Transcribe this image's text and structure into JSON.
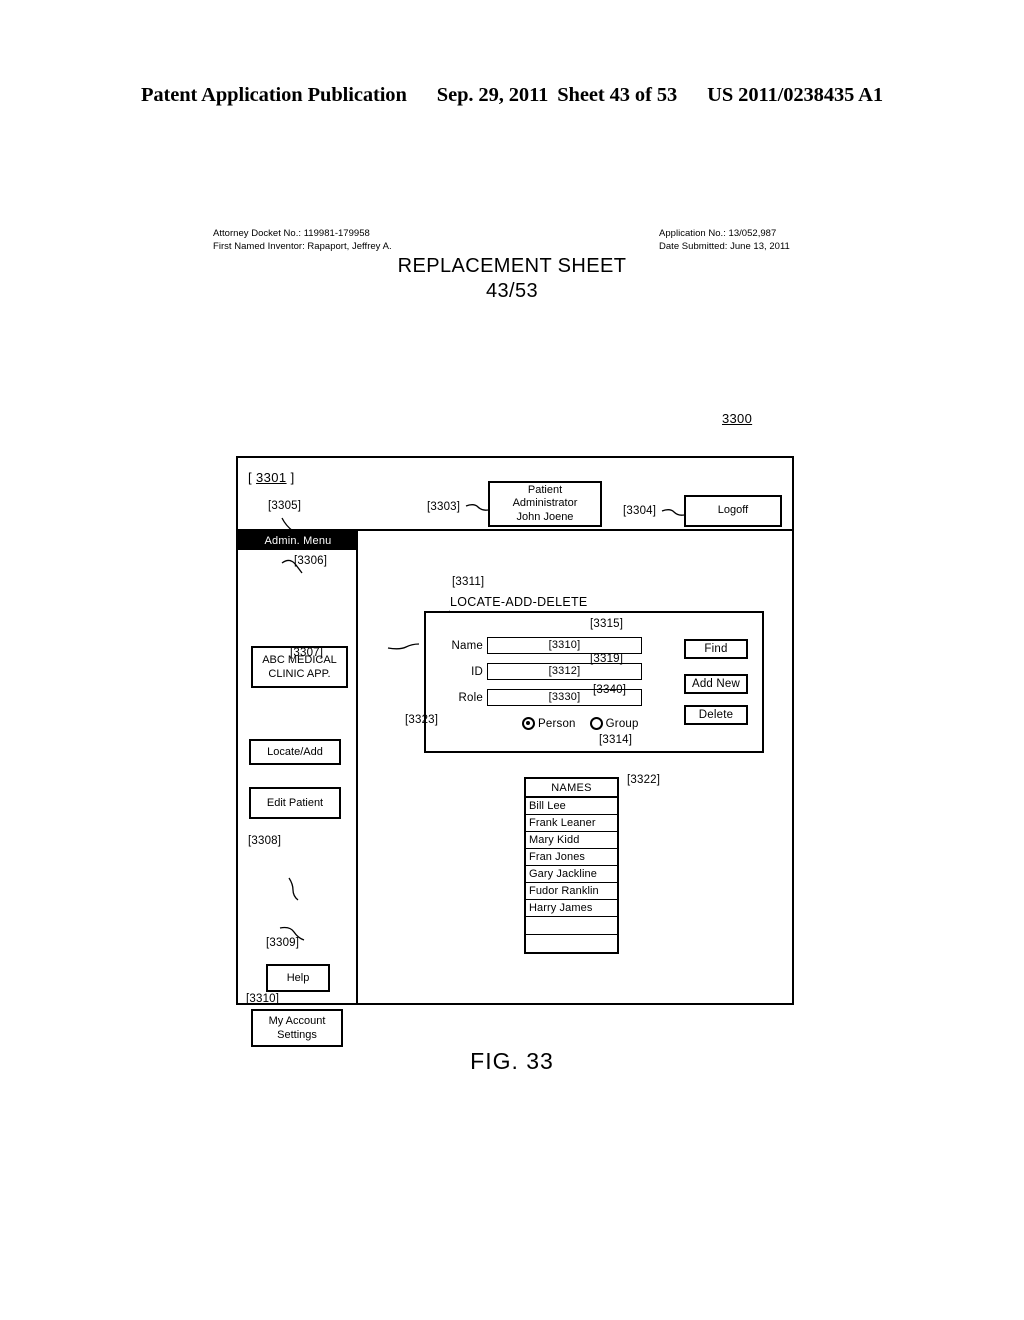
{
  "publication_header": {
    "publication": "Patent Application Publication",
    "date": "Sep. 29, 2011",
    "sheet": "Sheet 43 of 53",
    "patent_number": "US 2011/0238435 A1"
  },
  "docket": {
    "attorney_docket": "Attorney Docket No.: 119981-179958",
    "first_named_inventor": "First Named Inventor: Rapaport, Jeffrey A.",
    "application_no": "Application No.: 13/052,987",
    "date_submitted": "Date Submitted: June 13, 2011"
  },
  "replacement_sheet": {
    "line1": "REPLACEMENT SHEET",
    "line2": "43/53"
  },
  "figure": {
    "caption": "FIG. 33",
    "figure_ref": "3300"
  },
  "window": {
    "ref_open_bracket": "[",
    "ref_number": "3301",
    "ref_close_bracket": "]",
    "topbar": {
      "admin_identity_ref": "[3303]",
      "admin_identity_line1": "Patient",
      "admin_identity_line2": "Administrator",
      "admin_identity_line3": "John Joene",
      "logoff_ref": "[3304]",
      "logoff_label": "Logoff"
    }
  },
  "sidebar": {
    "title_ref": "[3305]",
    "title": "Admin. Menu",
    "items": [
      {
        "ref": "[3306]",
        "line1": "ABC MEDICAL",
        "line2": "CLINIC APP."
      },
      {
        "ref": "[3307]",
        "line1": "Locate/Add",
        "line2": ""
      },
      {
        "ref": "[3308]",
        "line1": "Edit Patient",
        "line2": ""
      },
      {
        "ref": "[3309]",
        "line1": "Help",
        "line2": ""
      },
      {
        "ref": "[3310]",
        "line1": "My Account",
        "line2": "Settings"
      }
    ]
  },
  "main": {
    "panel_ref": "[3311]",
    "panel_title": "LOCATE-ADD-DELETE",
    "fields": [
      {
        "label": "Name",
        "value": "[3310]"
      },
      {
        "label": "ID",
        "value": "[3312]"
      },
      {
        "label": "Role",
        "value": "[3330]"
      }
    ],
    "radio": {
      "ref_person": "[3323]",
      "ref_group": "[3314]",
      "options": [
        {
          "label": "Person",
          "selected": true
        },
        {
          "label": "Group",
          "selected": false
        }
      ]
    },
    "buttons": [
      {
        "ref": "[3315]",
        "label": "Find"
      },
      {
        "ref": "[3319]",
        "label": "Add New"
      },
      {
        "ref": "[3340]",
        "label": "Delete"
      }
    ],
    "names_list": {
      "ref": "[3322]",
      "header": "NAMES",
      "rows": [
        "Bill Lee",
        "Frank Leaner",
        "Mary Kidd",
        "Fran Jones",
        "Gary Jackline",
        "Fudor Ranklin",
        "Harry James",
        "",
        ""
      ]
    }
  }
}
